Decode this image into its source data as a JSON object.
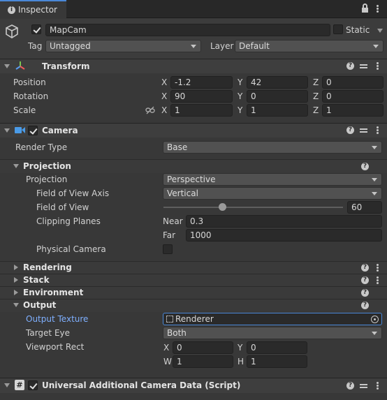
{
  "tab": {
    "title": "Inspector"
  },
  "object": {
    "name": "MapCam",
    "static_label": "Static",
    "tag_label": "Tag",
    "tag_value": "Untagged",
    "layer_label": "Layer",
    "layer_value": "Default"
  },
  "transform": {
    "title": "Transform",
    "position_label": "Position",
    "rotation_label": "Rotation",
    "scale_label": "Scale",
    "axes": {
      "x": "X",
      "y": "Y",
      "z": "Z"
    },
    "position": {
      "x": "-1.2",
      "y": "42",
      "z": "0"
    },
    "rotation": {
      "x": "90",
      "y": "0",
      "z": "0"
    },
    "scale": {
      "x": "1",
      "y": "1",
      "z": "1"
    }
  },
  "camera": {
    "title": "Camera",
    "render_type_label": "Render Type",
    "render_type_value": "Base",
    "projection": {
      "title": "Projection",
      "projection_label": "Projection",
      "projection_value": "Perspective",
      "fov_axis_label": "Field of View Axis",
      "fov_axis_value": "Vertical",
      "fov_label": "Field of View",
      "fov_value": "60",
      "fov_fraction": 0.33,
      "clipping_label": "Clipping Planes",
      "near_label": "Near",
      "near_value": "0.3",
      "far_label": "Far",
      "far_value": "1000",
      "physical_label": "Physical Camera"
    },
    "sections": {
      "rendering": "Rendering",
      "stack": "Stack",
      "environment": "Environment"
    },
    "output": {
      "title": "Output",
      "texture_label": "Output Texture",
      "texture_value": "Renderer",
      "target_eye_label": "Target Eye",
      "target_eye_value": "Both",
      "viewport_label": "Viewport Rect",
      "x_label": "X",
      "x_value": "0",
      "y_label": "Y",
      "y_value": "0",
      "w_label": "W",
      "w_value": "1",
      "h_label": "H",
      "h_value": "1"
    }
  },
  "script": {
    "title": "Universal Additional Camera Data (Script)"
  },
  "colors": {
    "accent_link": "#7fb0ff",
    "background": "#383838"
  }
}
